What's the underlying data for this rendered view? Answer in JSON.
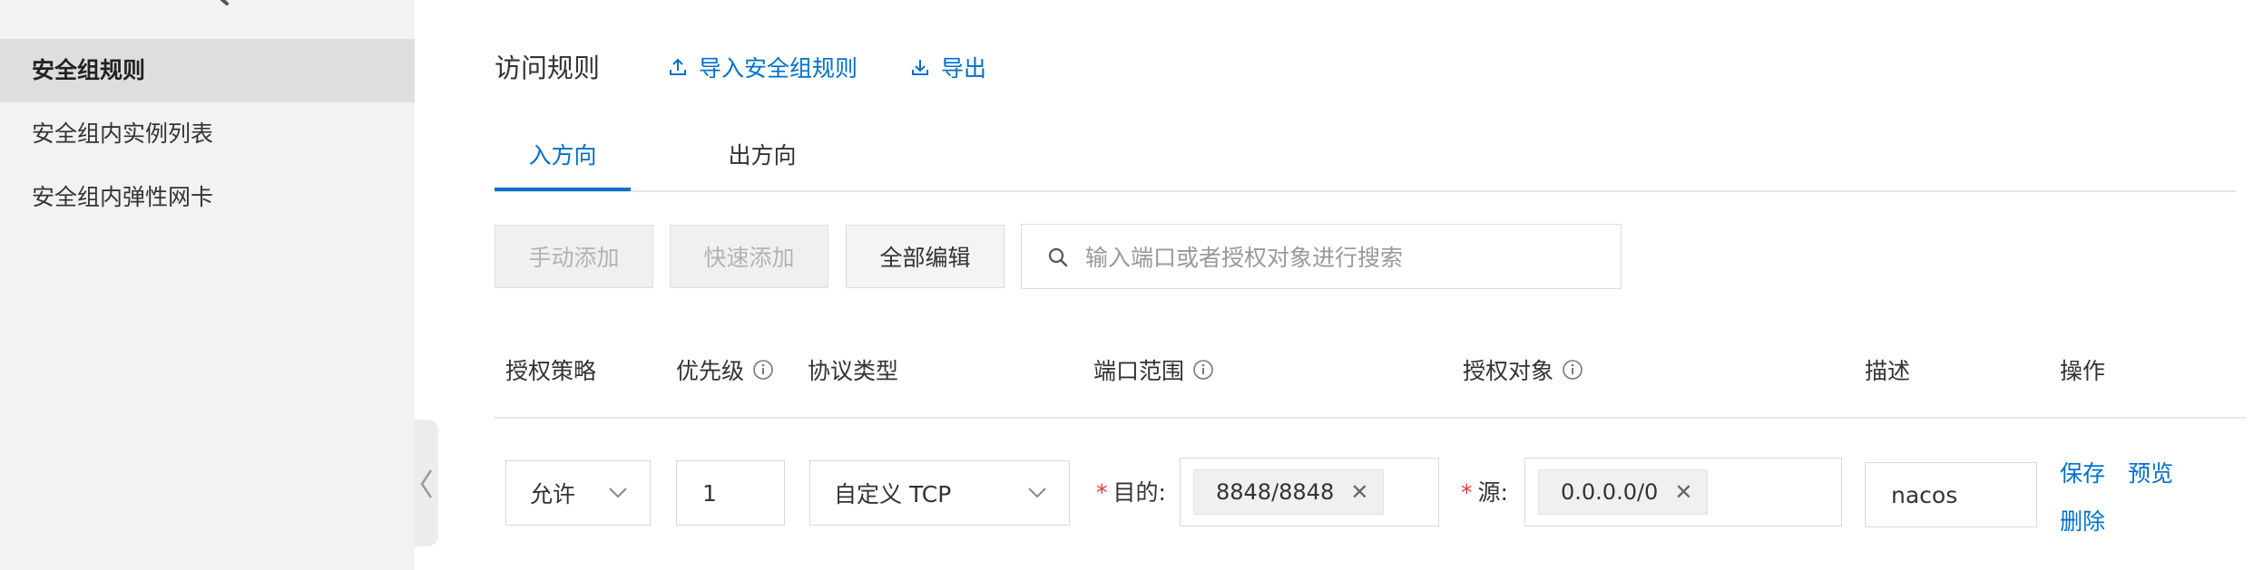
{
  "sidebar": {
    "items": [
      {
        "label": "安全组规则",
        "active": true
      },
      {
        "label": "安全组内实例列表",
        "active": false
      },
      {
        "label": "安全组内弹性网卡",
        "active": false
      }
    ]
  },
  "header": {
    "title": "访问规则",
    "import_label": "导入安全组规则",
    "export_label": "导出"
  },
  "tabs": [
    {
      "label": "入方向",
      "active": true
    },
    {
      "label": "出方向",
      "active": false
    }
  ],
  "toolbar": {
    "manual_add_label": "手动添加",
    "quick_add_label": "快速添加",
    "edit_all_label": "全部编辑",
    "search_placeholder": "输入端口或者授权对象进行搜索"
  },
  "table": {
    "columns": {
      "policy": "授权策略",
      "priority": "优先级",
      "protocol": "协议类型",
      "port_range": "端口范围",
      "auth_object": "授权对象",
      "description": "描述",
      "actions": "操作"
    },
    "row": {
      "policy": "允许",
      "priority": "1",
      "protocol": "自定义 TCP",
      "dest_label": "目的",
      "port_tag": "8848/8848",
      "source_label": "源",
      "source_tag": "0.0.0.0/0",
      "description": "nacos",
      "save_label": "保存",
      "preview_label": "预览",
      "delete_label": "删除"
    }
  },
  "colors": {
    "accent": "#0070cc",
    "required": "#e0383e",
    "sidebar_bg": "#f2f2f2",
    "sidebar_active_bg": "#dedede"
  },
  "icons": {
    "back": "chevron-left-icon",
    "import": "upload-icon",
    "export": "download-icon",
    "search": "search-icon",
    "info": "info-circle-icon",
    "dropdown": "chevron-down-icon",
    "remove_tag": "close-icon"
  }
}
